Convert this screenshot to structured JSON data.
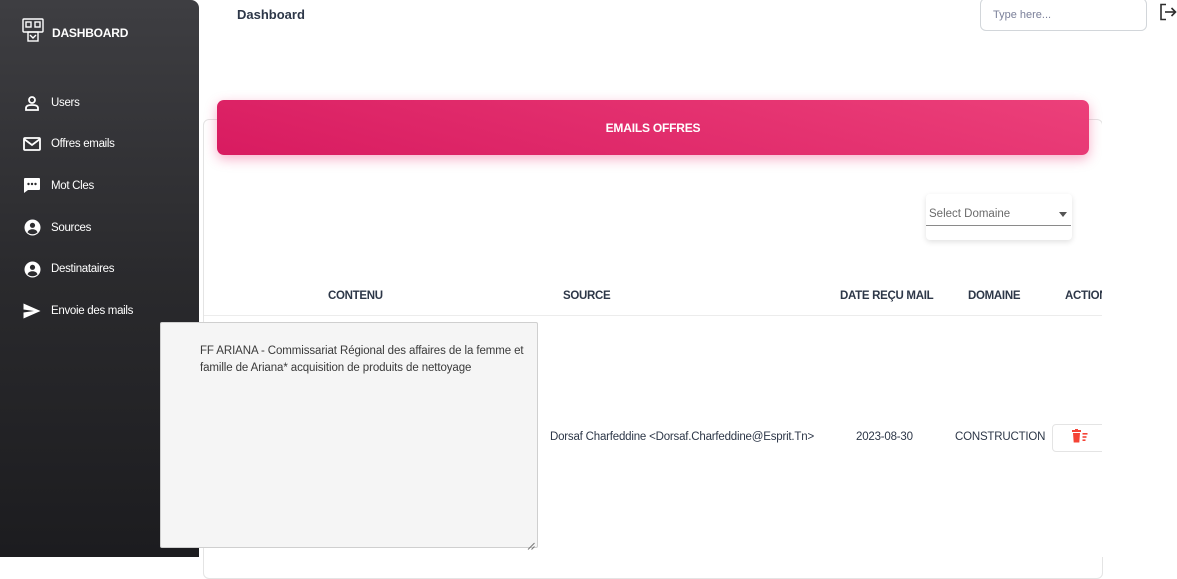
{
  "sidebar": {
    "brand": {
      "label": "DASHBOARD",
      "icon": "dashboard-icon"
    },
    "items": [
      {
        "label": "Users",
        "icon": "user-icon"
      },
      {
        "label": "Offres emails",
        "icon": "mail-icon"
      },
      {
        "label": "Mot Cles",
        "icon": "chat-bubble-icon"
      },
      {
        "label": "Sources",
        "icon": "account-circle-icon"
      },
      {
        "label": "Destinataires",
        "icon": "account-circle-icon"
      },
      {
        "label": "Envoie des mails",
        "icon": "send-icon"
      }
    ]
  },
  "topbar": {
    "title": "Dashboard",
    "search_placeholder": "Type here...",
    "logout_icon": "logout-icon"
  },
  "card": {
    "header": "EMAILS OFFRES",
    "filter": {
      "selected": "Select Domaine"
    },
    "columns": [
      "CONTENU",
      "SOURCE",
      "DATE REÇU MAIL",
      "DOMAINE",
      "ACTION"
    ],
    "rows": [
      {
        "contenu": "FF ARIANA - Commissariat Régional des affaires de la femme et famille de Ariana* acquisition de produits de nettoyage",
        "source": "Dorsaf Charfeddine <Dorsaf.Charfeddine@Esprit.Tn>",
        "date": "2023-08-30",
        "domaine": "CONSTRUCTION",
        "action_icon": "delete-icon"
      }
    ]
  },
  "colors": {
    "accent": "#e91e63",
    "sidebar": "#2a2a2d",
    "delete": "#f44335"
  }
}
